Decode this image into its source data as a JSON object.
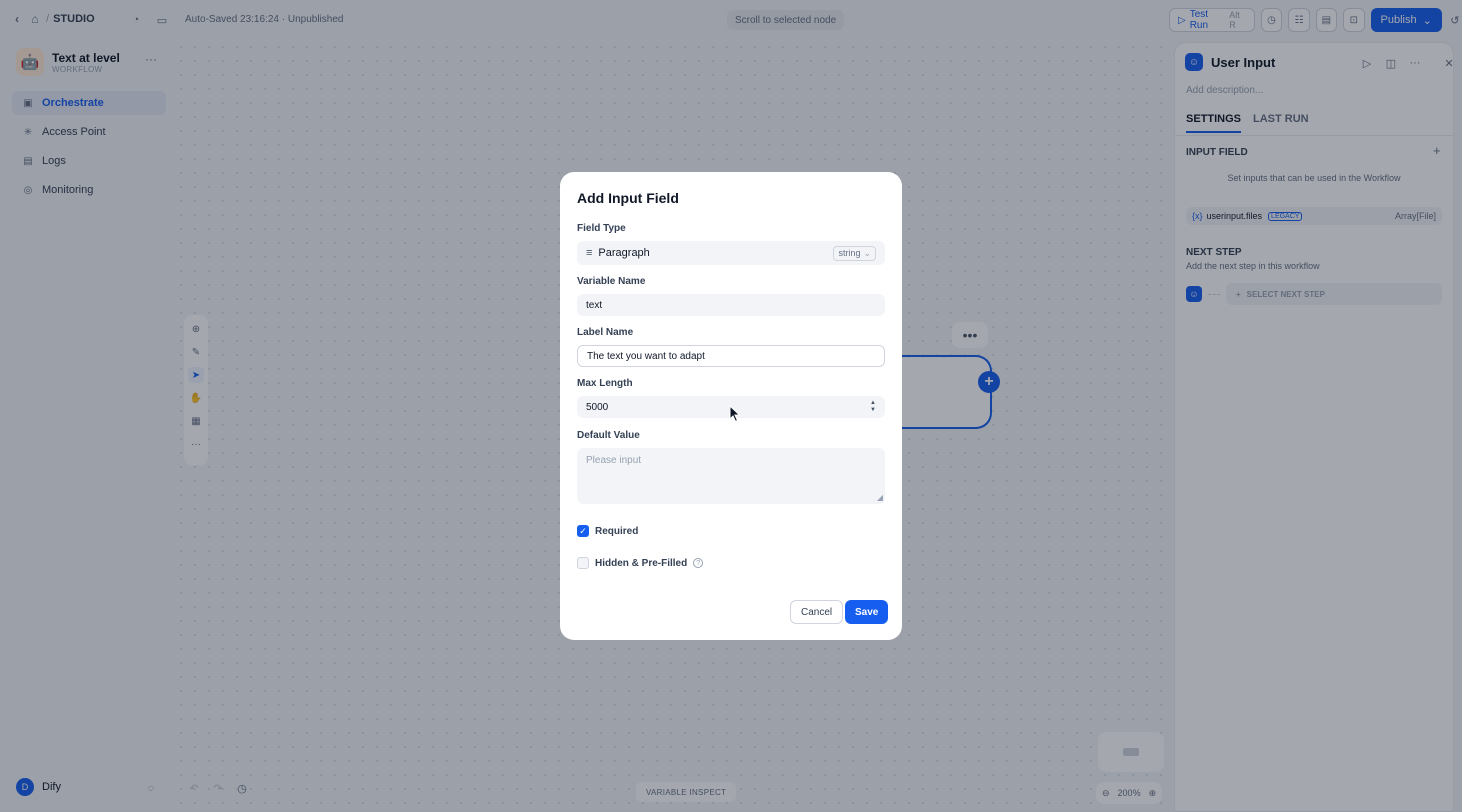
{
  "topbar": {
    "studio_label": "STUDIO",
    "autosave": "Auto-Saved 23:16:24 · Unpublished",
    "scroll_pill": "Scroll to selected node",
    "test_run": "Test Run",
    "test_run_shortcut": "Alt R",
    "publish": "Publish"
  },
  "sidebar": {
    "app_name": "Text at level",
    "app_type": "WORKFLOW",
    "items": [
      {
        "label": "Orchestrate",
        "icon": "orchestrate-icon",
        "active": true
      },
      {
        "label": "Access Point",
        "icon": "access-point-icon",
        "active": false
      },
      {
        "label": "Logs",
        "icon": "logs-icon",
        "active": false
      },
      {
        "label": "Monitoring",
        "icon": "monitoring-icon",
        "active": false
      }
    ],
    "user_initial": "D",
    "user_name": "Dify"
  },
  "canvas": {
    "variable_inspect": "VARIABLE INSPECT",
    "zoom": "200%"
  },
  "panel": {
    "title": "User Input",
    "description_placeholder": "Add description...",
    "tabs": [
      "SETTINGS",
      "LAST RUN"
    ],
    "input_field_title": "INPUT FIELD",
    "input_field_hint": "Set inputs that can be used in the Workflow",
    "var_brace": "{x}",
    "var_name": "userinput.files",
    "var_badge": "LEGACY",
    "var_type": "Array[File]",
    "next_step_title": "NEXT STEP",
    "next_step_hint": "Add the next step in this workflow",
    "select_next": "SELECT NEXT STEP"
  },
  "modal": {
    "title": "Add Input Field",
    "field_type_label": "Field Type",
    "field_type_value": "Paragraph",
    "field_type_tag": "string",
    "variable_name_label": "Variable Name",
    "variable_name_value": "text",
    "label_name_label": "Label Name",
    "label_name_value": "The text you want to adapt",
    "max_length_label": "Max Length",
    "max_length_value": "5000",
    "default_value_label": "Default Value",
    "default_value_placeholder": "Please input",
    "required_label": "Required",
    "required_checked": true,
    "hidden_label": "Hidden & Pre-Filled",
    "hidden_checked": false,
    "cancel": "Cancel",
    "save": "Save"
  },
  "colors": {
    "accent": "#155eef",
    "overlay": "rgba(16,24,40,0.38)"
  }
}
